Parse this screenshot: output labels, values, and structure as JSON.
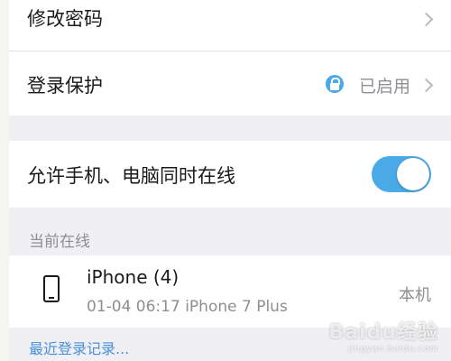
{
  "settings": {
    "change_password": {
      "label": "修改密码"
    },
    "login_protection": {
      "label": "登录保护",
      "status": "已启用"
    },
    "multi_device": {
      "label": "允许手机、电脑同时在线",
      "enabled": true
    }
  },
  "online_section": {
    "title": "当前在线",
    "devices": [
      {
        "name": "iPhone (4)",
        "meta": "01-04 06:17  iPhone 7 Plus",
        "tag": "本机",
        "icon": "phone-icon"
      }
    ],
    "recent_link": "最近登录记录..."
  },
  "watermark": {
    "brand": "Baidu经验",
    "url": "jingyan.baidu.com"
  },
  "colors": {
    "accent": "#4aaae8",
    "link": "#4a90d9",
    "background": "#efeff4"
  }
}
